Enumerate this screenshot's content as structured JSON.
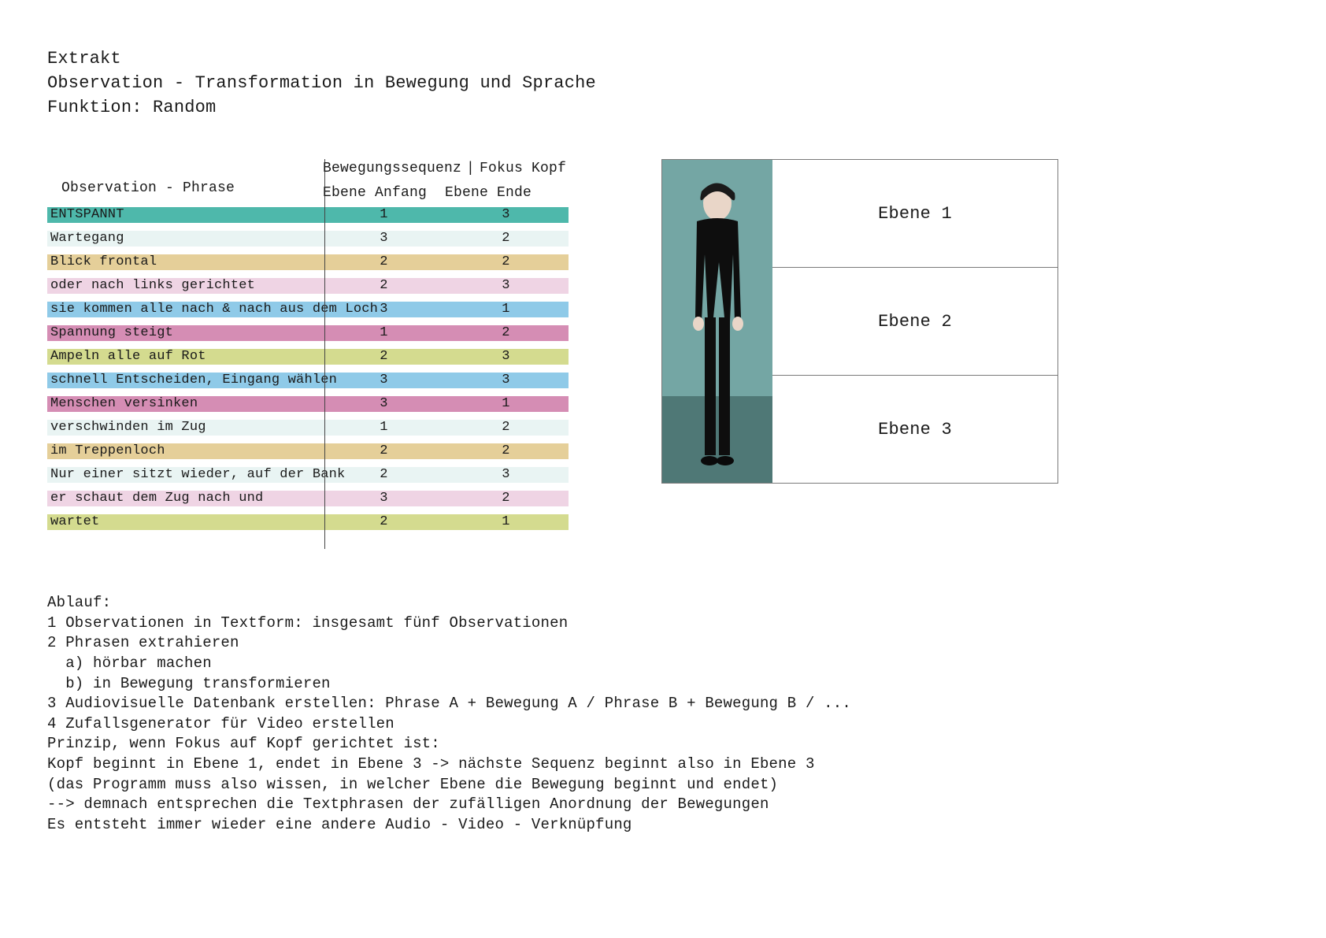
{
  "header": {
    "l1": "Extrakt",
    "l2": "Observation - Transformation in Bewegung und Sprache",
    "l3": "Funktion: Random"
  },
  "table": {
    "head": {
      "col1": "Observation - Phrase",
      "top1": "Bewegungssequenz",
      "top2": "Fokus Kopf",
      "sub1": "Ebene Anfang",
      "sub2": "Ebene Ende"
    },
    "rows": [
      {
        "cls": "teal",
        "phrase": "ENTSPANNT",
        "a": "1",
        "e": "3"
      },
      {
        "cls": "skyA",
        "phrase": "Wartegang",
        "a": "3",
        "e": "2"
      },
      {
        "cls": "tan",
        "phrase": "Blick frontal",
        "a": "2",
        "e": "2"
      },
      {
        "cls": "pinkL",
        "phrase": "oder nach links gerichtet",
        "a": "2",
        "e": "3"
      },
      {
        "cls": "blue",
        "phrase": "sie kommen alle nach & nach aus dem Loch",
        "a": "3",
        "e": "1"
      },
      {
        "cls": "mag",
        "phrase": "Spannung steigt",
        "a": "1",
        "e": "2"
      },
      {
        "cls": "olive",
        "phrase": "Ampeln alle auf Rot",
        "a": "2",
        "e": "3"
      },
      {
        "cls": "blue",
        "phrase": "schnell Entscheiden, Eingang wählen",
        "a": "3",
        "e": "3"
      },
      {
        "cls": "mag",
        "phrase": "Menschen versinken",
        "a": "3",
        "e": "1"
      },
      {
        "cls": "skyB",
        "phrase": "verschwinden im Zug",
        "a": "1",
        "e": "2"
      },
      {
        "cls": "tan",
        "phrase": "im Treppenloch",
        "a": "2",
        "e": "2"
      },
      {
        "cls": "skyA",
        "phrase": "Nur einer sitzt wieder, auf der Bank",
        "a": "2",
        "e": "3"
      },
      {
        "cls": "pinkL",
        "phrase": "er schaut dem Zug nach und",
        "a": "3",
        "e": "2"
      },
      {
        "cls": "olive",
        "phrase": "wartet",
        "a": "2",
        "e": "1"
      }
    ]
  },
  "levels": [
    "Ebene 1",
    "Ebene 2",
    "Ebene 3"
  ],
  "proc": {
    "title": "Ablauf:",
    "lines": [
      "1 Observationen in Textform: insgesamt fünf Observationen",
      "2 Phrasen extrahieren",
      "  a) hörbar machen",
      "  b) in Bewegung transformieren",
      "3 Audiovisuelle Datenbank erstellen: Phrase A + Bewegung A / Phrase B + Bewegung B / ...",
      "4 Zufallsgenerator für Video erstellen",
      "Prinzip, wenn Fokus auf Kopf gerichtet ist:",
      "Kopf beginnt in Ebene 1, endet in Ebene 3 -> nächste Sequenz beginnt also in Ebene 3",
      "(das Programm muss also wissen, in welcher Ebene die Bewegung beginnt und endet)",
      "--> demnach entsprechen die Textphrasen der zufälligen Anordnung der Bewegungen",
      "Es entsteht immer wieder eine andere Audio - Video - Verknüpfung"
    ]
  }
}
